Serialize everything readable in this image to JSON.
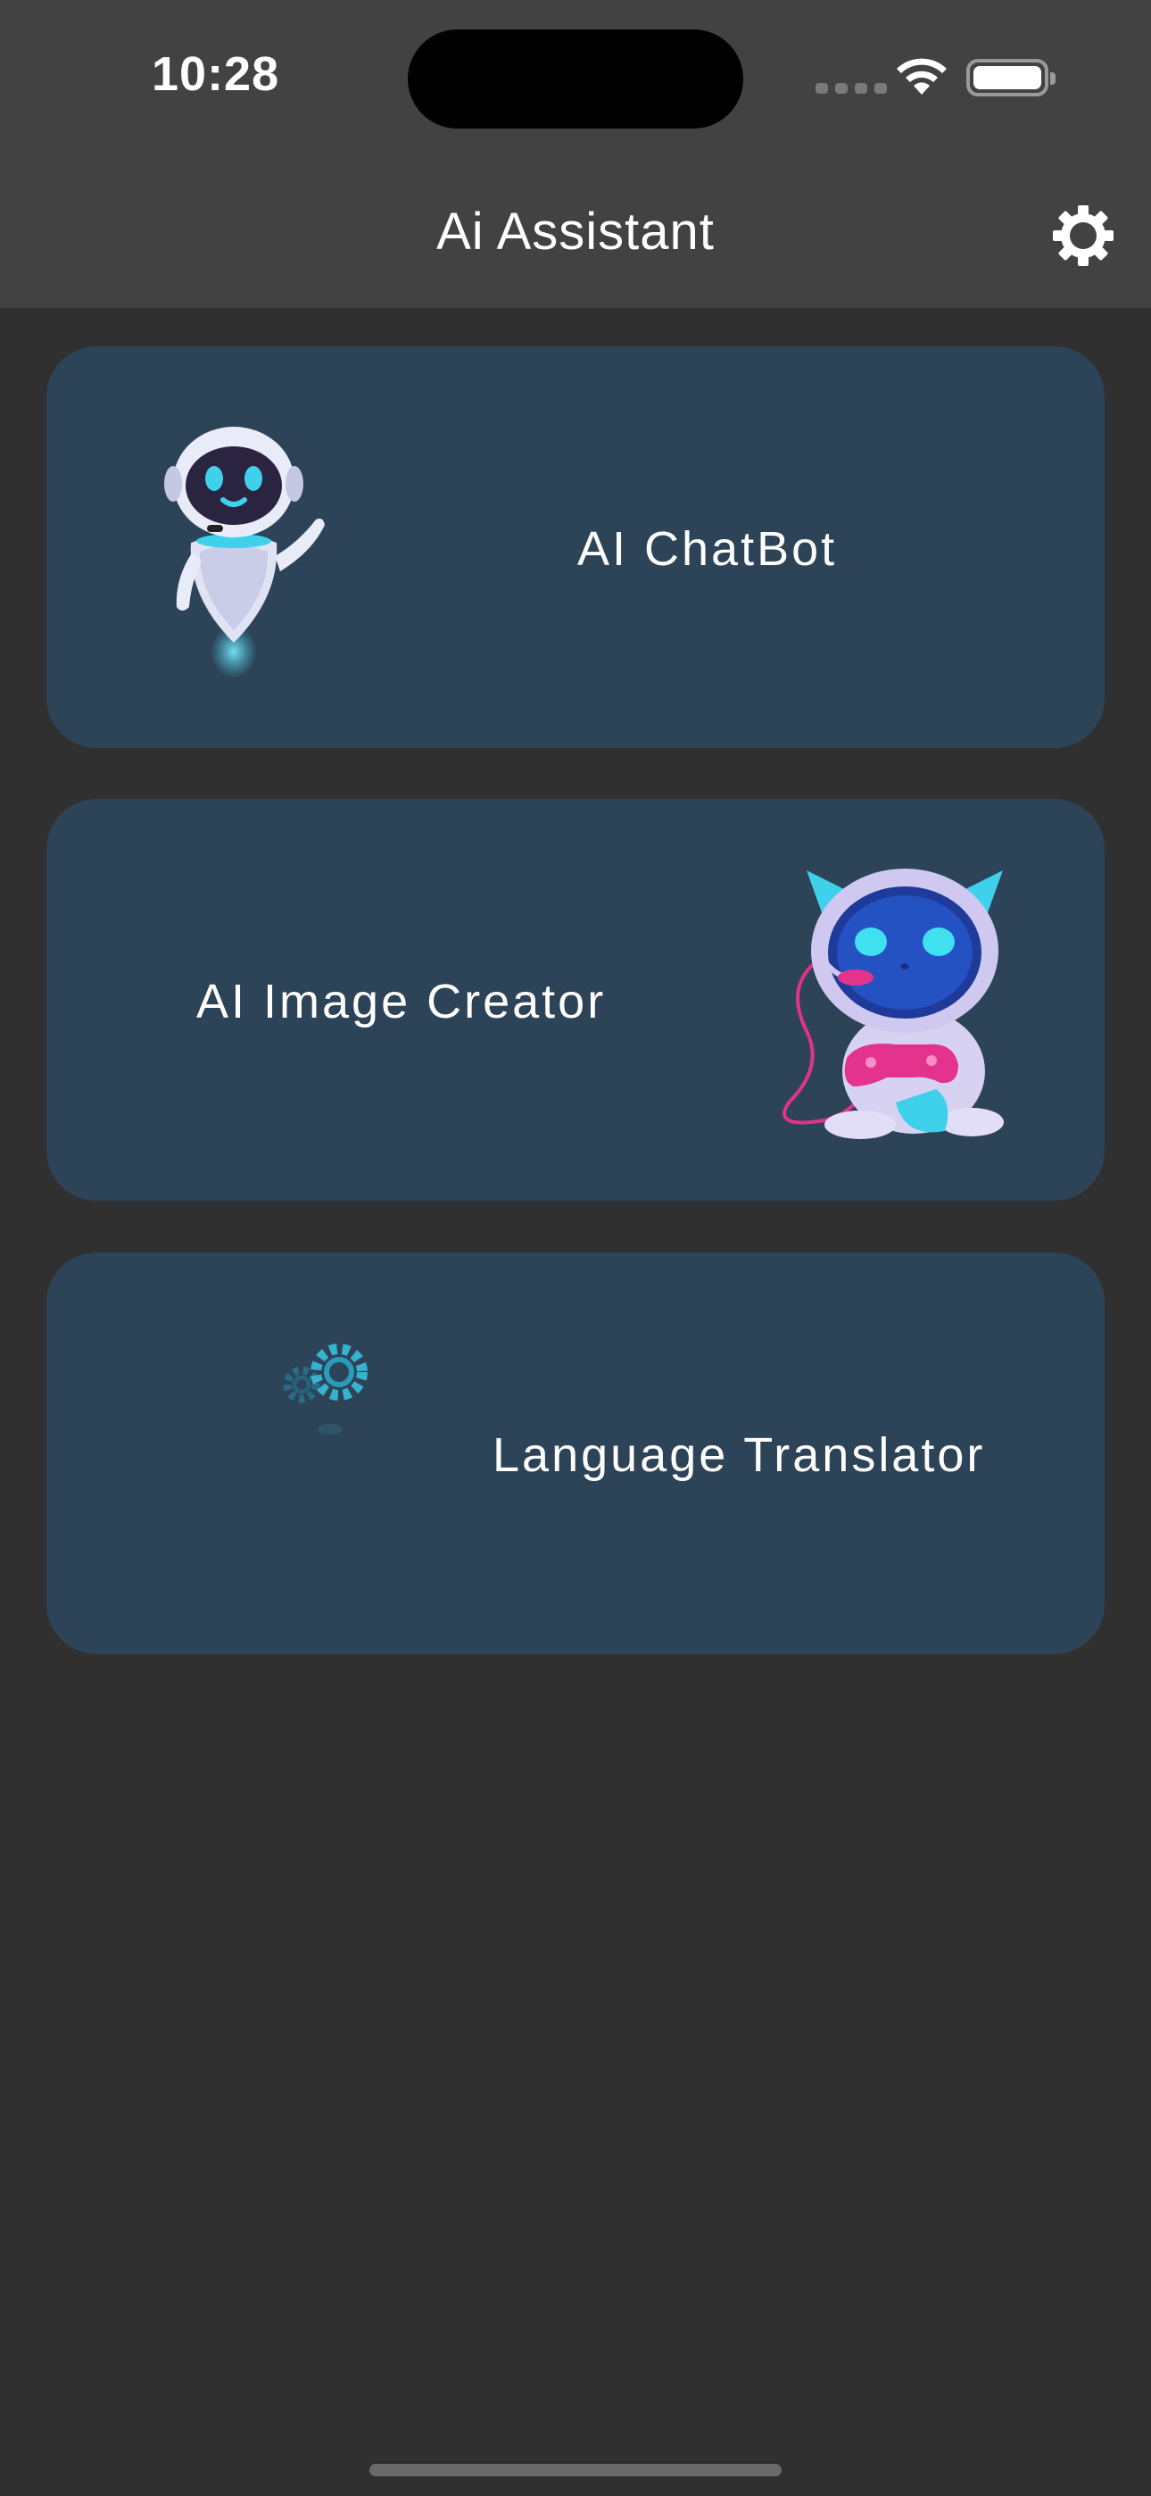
{
  "status_bar": {
    "time": "10:28"
  },
  "app_bar": {
    "title": "Ai Assistant",
    "settings_icon": "gear-icon"
  },
  "cards": [
    {
      "label": "AI ChatBot",
      "illustration": "robot-waving-illustration"
    },
    {
      "label": "AI Image Creator",
      "illustration": "robot-gamer-illustration"
    },
    {
      "label": "Language Translator",
      "illustration": "gears-loading-illustration"
    }
  ],
  "colors": {
    "background": "#303030",
    "app_bar": "#424242",
    "card": "#2d4357",
    "accent_cyan": "#3fd0ec"
  }
}
